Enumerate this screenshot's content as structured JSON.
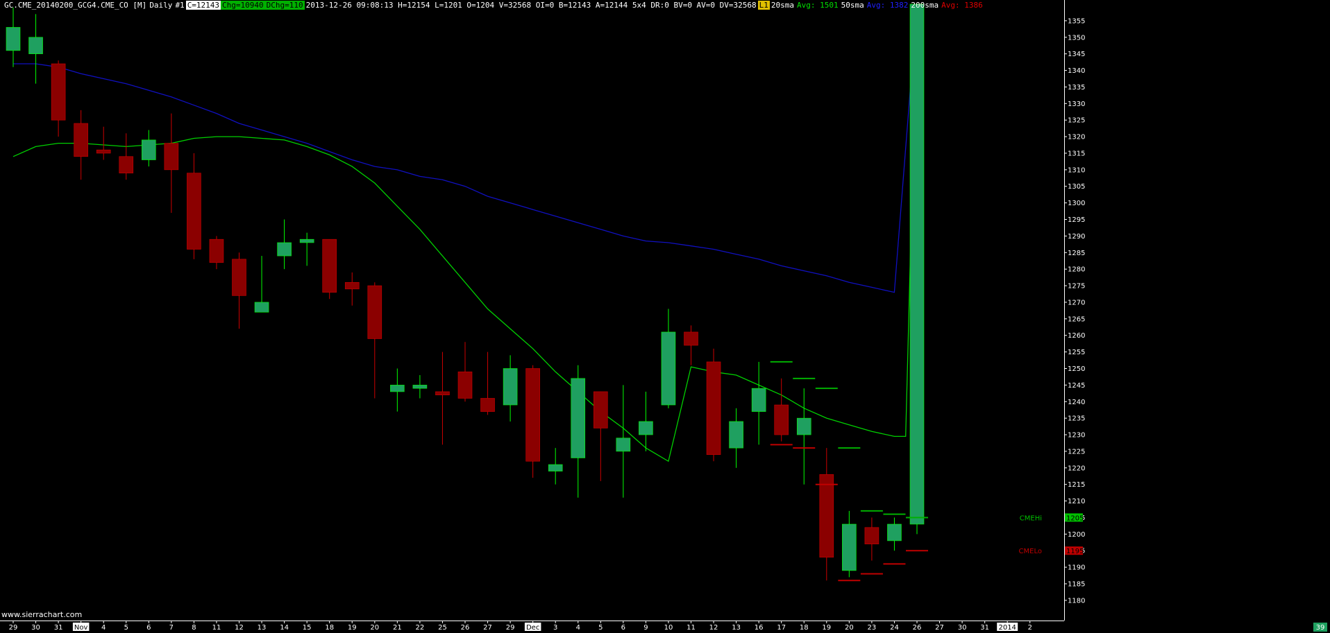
{
  "header": {
    "symbol": "GC.CME_20140200_GCG4.CME_CO [M]",
    "timeframe": "Daily",
    "chart_number": "#1",
    "close_box": "C=12143",
    "chg_box": "Chg=10940",
    "dchg_box": "DChg=110",
    "stats": "2013-12-26 09:08:13 H=12154 L=1201 O=1204 V=32568 OI=0 B=12143 A=12144 5x4 DR:0 BV=0 AV=0 DV=32568",
    "flag": "L1",
    "sma20_label": "20sma",
    "sma20_avg": "Avg: 1501",
    "sma50_label": "50sma",
    "sma50_avg": "Avg: 1382",
    "sma200_label": "200sma",
    "sma200_avg": "Avg: 1386"
  },
  "watermark": "www.sierrachart.com",
  "colors": {
    "bg": "#000000",
    "up": "#1fa060",
    "up_wick": "#00ff00",
    "down": "#8b0000",
    "down_wick": "#cc0000",
    "sma_green": "#00d000",
    "sma_blue": "#1010c0",
    "axis": "#ffffff",
    "hi_label": "#00c000",
    "lo_label": "#c00000"
  },
  "chart_data": {
    "type": "candlestick",
    "ylim": [
      1176,
      1360
    ],
    "y_ticks": [
      1180,
      1185,
      1190,
      1195,
      1200,
      1205,
      1210,
      1215,
      1220,
      1225,
      1230,
      1235,
      1240,
      1245,
      1250,
      1255,
      1260,
      1265,
      1270,
      1275,
      1280,
      1285,
      1290,
      1295,
      1300,
      1305,
      1310,
      1315,
      1320,
      1325,
      1330,
      1335,
      1340,
      1345,
      1350,
      1355
    ],
    "x_labels": [
      "29",
      "30",
      "31",
      "Nov",
      "4",
      "5",
      "6",
      "7",
      "8",
      "11",
      "12",
      "13",
      "14",
      "15",
      "18",
      "19",
      "20",
      "21",
      "22",
      "25",
      "26",
      "27",
      "29",
      "Dec",
      "3",
      "4",
      "5",
      "6",
      "9",
      "10",
      "11",
      "12",
      "13",
      "16",
      "17",
      "18",
      "19",
      "20",
      "23",
      "24",
      "26",
      "27",
      "30",
      "31",
      "2014",
      "2"
    ],
    "highlighted_x_labels": [
      "Nov",
      "Dec",
      "2014"
    ],
    "candles": [
      {
        "o": 1346,
        "h": 1359,
        "l": 1341,
        "c": 1353
      },
      {
        "o": 1345,
        "h": 1357,
        "l": 1336,
        "c": 1350
      },
      {
        "o": 1342,
        "h": 1343,
        "l": 1320,
        "c": 1325
      },
      {
        "o": 1324,
        "h": 1328,
        "l": 1307,
        "c": 1314
      },
      {
        "o": 1316,
        "h": 1323,
        "l": 1313,
        "c": 1315
      },
      {
        "o": 1314,
        "h": 1321,
        "l": 1307,
        "c": 1309
      },
      {
        "o": 1313,
        "h": 1322,
        "l": 1311,
        "c": 1319
      },
      {
        "o": 1318,
        "h": 1327,
        "l": 1297,
        "c": 1310
      },
      {
        "o": 1309,
        "h": 1315,
        "l": 1283,
        "c": 1286
      },
      {
        "o": 1289,
        "h": 1290,
        "l": 1280,
        "c": 1282
      },
      {
        "o": 1283,
        "h": 1285,
        "l": 1262,
        "c": 1272
      },
      {
        "o": 1267,
        "h": 1284,
        "l": 1267,
        "c": 1270
      },
      {
        "o": 1284,
        "h": 1295,
        "l": 1280,
        "c": 1288
      },
      {
        "o": 1288,
        "h": 1291,
        "l": 1281,
        "c": 1289
      },
      {
        "o": 1289,
        "h": 1289,
        "l": 1271,
        "c": 1273
      },
      {
        "o": 1276,
        "h": 1279,
        "l": 1269,
        "c": 1274
      },
      {
        "o": 1275,
        "h": 1276,
        "l": 1241,
        "c": 1259
      },
      {
        "o": 1243,
        "h": 1250,
        "l": 1237,
        "c": 1245
      },
      {
        "o": 1244,
        "h": 1248,
        "l": 1241,
        "c": 1245
      },
      {
        "o": 1243,
        "h": 1255,
        "l": 1227,
        "c": 1242
      },
      {
        "o": 1249,
        "h": 1258,
        "l": 1240,
        "c": 1241
      },
      {
        "o": 1241,
        "h": 1255,
        "l": 1236,
        "c": 1237
      },
      {
        "o": 1239,
        "h": 1254,
        "l": 1234,
        "c": 1250
      },
      {
        "o": 1250,
        "h": 1251,
        "l": 1217,
        "c": 1222
      },
      {
        "o": 1219,
        "h": 1226,
        "l": 1215,
        "c": 1221
      },
      {
        "o": 1223,
        "h": 1251,
        "l": 1211,
        "c": 1247
      },
      {
        "o": 1243,
        "h": 1243,
        "l": 1216,
        "c": 1232
      },
      {
        "o": 1225,
        "h": 1245,
        "l": 1211,
        "c": 1229
      },
      {
        "o": 1230,
        "h": 1243,
        "l": 1225,
        "c": 1234
      },
      {
        "o": 1239,
        "h": 1268,
        "l": 1238,
        "c": 1261
      },
      {
        "o": 1261,
        "h": 1263,
        "l": 1251,
        "c": 1257
      },
      {
        "o": 1252,
        "h": 1256,
        "l": 1222,
        "c": 1224
      },
      {
        "o": 1226,
        "h": 1238,
        "l": 1220,
        "c": 1234
      },
      {
        "o": 1237,
        "h": 1252,
        "l": 1227,
        "c": 1244
      },
      {
        "o": 1239,
        "h": 1247,
        "l": 1228,
        "c": 1230
      },
      {
        "o": 1230,
        "h": 1244,
        "l": 1215,
        "c": 1235
      },
      {
        "o": 1218,
        "h": 1226,
        "l": 1186,
        "c": 1193
      },
      {
        "o": 1189,
        "h": 1207,
        "l": 1187,
        "c": 1203
      },
      {
        "o": 1202,
        "h": 1205,
        "l": 1192,
        "c": 1197
      },
      {
        "o": 1198,
        "h": 1205,
        "l": 1195,
        "c": 1203
      },
      {
        "o": 1203,
        "h": 1360,
        "l": 1200,
        "c": 1360
      }
    ],
    "sma_green": [
      [
        0,
        1314
      ],
      [
        1,
        1317
      ],
      [
        2,
        1318
      ],
      [
        3,
        1318
      ],
      [
        4,
        1317.5
      ],
      [
        5,
        1317
      ],
      [
        6,
        1317.5
      ],
      [
        7,
        1318
      ],
      [
        8,
        1319.5
      ],
      [
        9,
        1320
      ],
      [
        10,
        1320
      ],
      [
        11,
        1319.5
      ],
      [
        12,
        1319
      ],
      [
        13,
        1317
      ],
      [
        14,
        1314.5
      ],
      [
        15,
        1311
      ],
      [
        16,
        1306
      ],
      [
        17,
        1299
      ],
      [
        18,
        1292
      ],
      [
        19,
        1284
      ],
      [
        20,
        1276
      ],
      [
        21,
        1268
      ],
      [
        22,
        1262
      ],
      [
        23,
        1256
      ],
      [
        24,
        1249
      ],
      [
        25,
        1243
      ],
      [
        26,
        1237
      ],
      [
        27,
        1232
      ],
      [
        28,
        1226
      ],
      [
        29,
        1222
      ],
      [
        30,
        1250.5
      ],
      [
        31,
        1249
      ],
      [
        32,
        1248
      ],
      [
        33,
        1245
      ],
      [
        34,
        1242
      ],
      [
        35,
        1238
      ],
      [
        36,
        1235
      ],
      [
        37,
        1233
      ],
      [
        38,
        1231
      ],
      [
        39,
        1229.5
      ],
      [
        39.5,
        1229.5
      ],
      [
        40,
        1360
      ]
    ],
    "sma_blue": [
      [
        0,
        1342
      ],
      [
        1,
        1342
      ],
      [
        2,
        1341
      ],
      [
        3,
        1339
      ],
      [
        4,
        1337.5
      ],
      [
        5,
        1336
      ],
      [
        6,
        1334
      ],
      [
        7,
        1332
      ],
      [
        8,
        1329.5
      ],
      [
        9,
        1327
      ],
      [
        10,
        1324
      ],
      [
        11,
        1322
      ],
      [
        12,
        1320
      ],
      [
        13,
        1318
      ],
      [
        14,
        1315.5
      ],
      [
        15,
        1313
      ],
      [
        16,
        1311
      ],
      [
        17,
        1310
      ],
      [
        18,
        1308
      ],
      [
        19,
        1307
      ],
      [
        20,
        1305
      ],
      [
        21,
        1302
      ],
      [
        22,
        1300
      ],
      [
        23,
        1298
      ],
      [
        24,
        1296
      ],
      [
        25,
        1294
      ],
      [
        26,
        1292
      ],
      [
        27,
        1290
      ],
      [
        28,
        1288.5
      ],
      [
        29,
        1288
      ],
      [
        30,
        1287
      ],
      [
        31,
        1286
      ],
      [
        32,
        1284.5
      ],
      [
        33,
        1283
      ],
      [
        34,
        1281
      ],
      [
        35,
        1279.5
      ],
      [
        36,
        1278
      ],
      [
        37,
        1276
      ],
      [
        38,
        1274.5
      ],
      [
        39,
        1273
      ],
      [
        40,
        1360
      ]
    ],
    "ticks_green": [
      {
        "x": 34,
        "y": 1252
      },
      {
        "x": 35,
        "y": 1247
      },
      {
        "x": 36,
        "y": 1244
      },
      {
        "x": 37,
        "y": 1226
      },
      {
        "x": 38,
        "y": 1207
      },
      {
        "x": 39,
        "y": 1206
      },
      {
        "x": 40,
        "y": 1205
      }
    ],
    "ticks_red": [
      {
        "x": 34,
        "y": 1227
      },
      {
        "x": 35,
        "y": 1226
      },
      {
        "x": 36,
        "y": 1215
      },
      {
        "x": 37,
        "y": 1186
      },
      {
        "x": 38,
        "y": 1188
      },
      {
        "x": 39,
        "y": 1191
      },
      {
        "x": 40,
        "y": 1195
      }
    ],
    "price_markers": [
      {
        "label": "CMEHi",
        "value": "1205",
        "price": 1205,
        "color": "#00c000"
      },
      {
        "label": "CMELo",
        "value": "1195",
        "price": 1195,
        "color": "#c00000"
      }
    ],
    "last_price_box": "39"
  }
}
